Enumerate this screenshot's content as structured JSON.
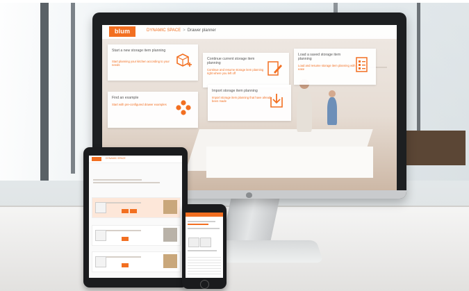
{
  "colors": {
    "brand_orange": "#f26f21",
    "device_black": "#1d1f21",
    "desk_white": "#f5f5f4"
  },
  "monitor_site": {
    "logo": "blum",
    "breadcrumb_link": "DYNAMIC SPACE",
    "breadcrumb_current": "Drawer planner",
    "tiles": [
      {
        "title": "Start a new storage item planning",
        "desc": "Start planning your kitchen according to your needs",
        "icon": "cube-plus-icon"
      },
      {
        "title": "Continue current storage item planning",
        "desc": "Continue and resume storage item planning right where you left off",
        "icon": "edit-document-icon"
      },
      {
        "title": "Load a saved storage item planning",
        "desc": "Load and resume storage item planning with ease",
        "icon": "list-document-icon"
      },
      {
        "title": "Find an example",
        "desc": "Start with pre-configured drawer examples",
        "icon": "dots-cluster-icon"
      },
      {
        "title": "Import storage item planning",
        "desc": "Import storage item planning that have already been made",
        "icon": "import-icon"
      }
    ]
  },
  "tablet_site": {
    "breadcrumb": "DYNAMIC SPACE"
  }
}
